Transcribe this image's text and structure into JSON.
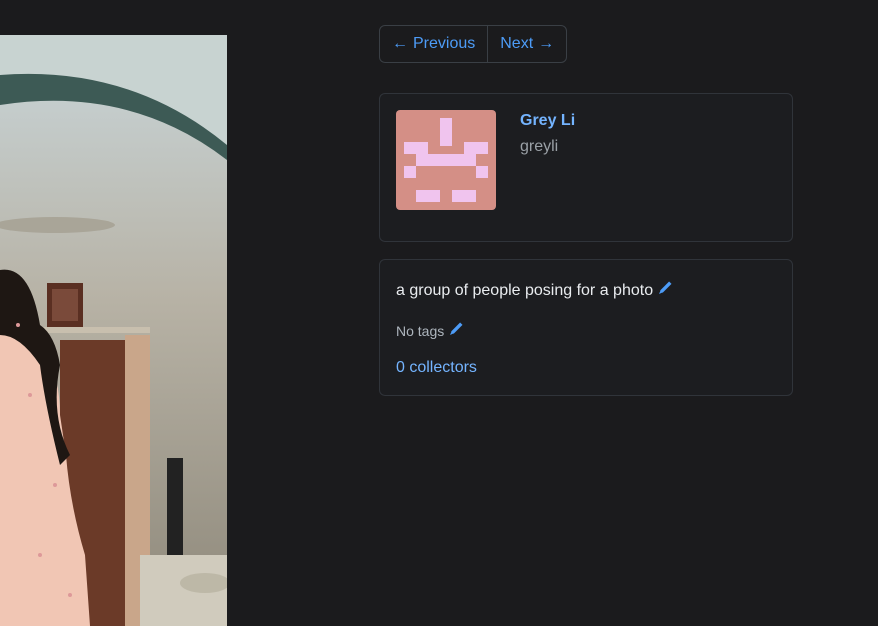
{
  "pager": {
    "previous_arrow": "←",
    "previous_label": "Previous",
    "next_label": "Next",
    "next_arrow": "→"
  },
  "user": {
    "name": "Grey Li",
    "username": "greyli",
    "avatar_bg": "#d48f86",
    "avatar_fg": "#f0c4ee"
  },
  "photo": {
    "description": "a group of people posing for a photo",
    "tags_text": "No tags",
    "collectors_text": "0 collectors"
  },
  "icons": {
    "edit": "pencil-icon",
    "prev": "arrow-left-icon",
    "next": "arrow-right-icon"
  },
  "colors": {
    "background": "#1b1b1d",
    "link": "#74b4ff",
    "button_text": "#4d9cf7"
  }
}
